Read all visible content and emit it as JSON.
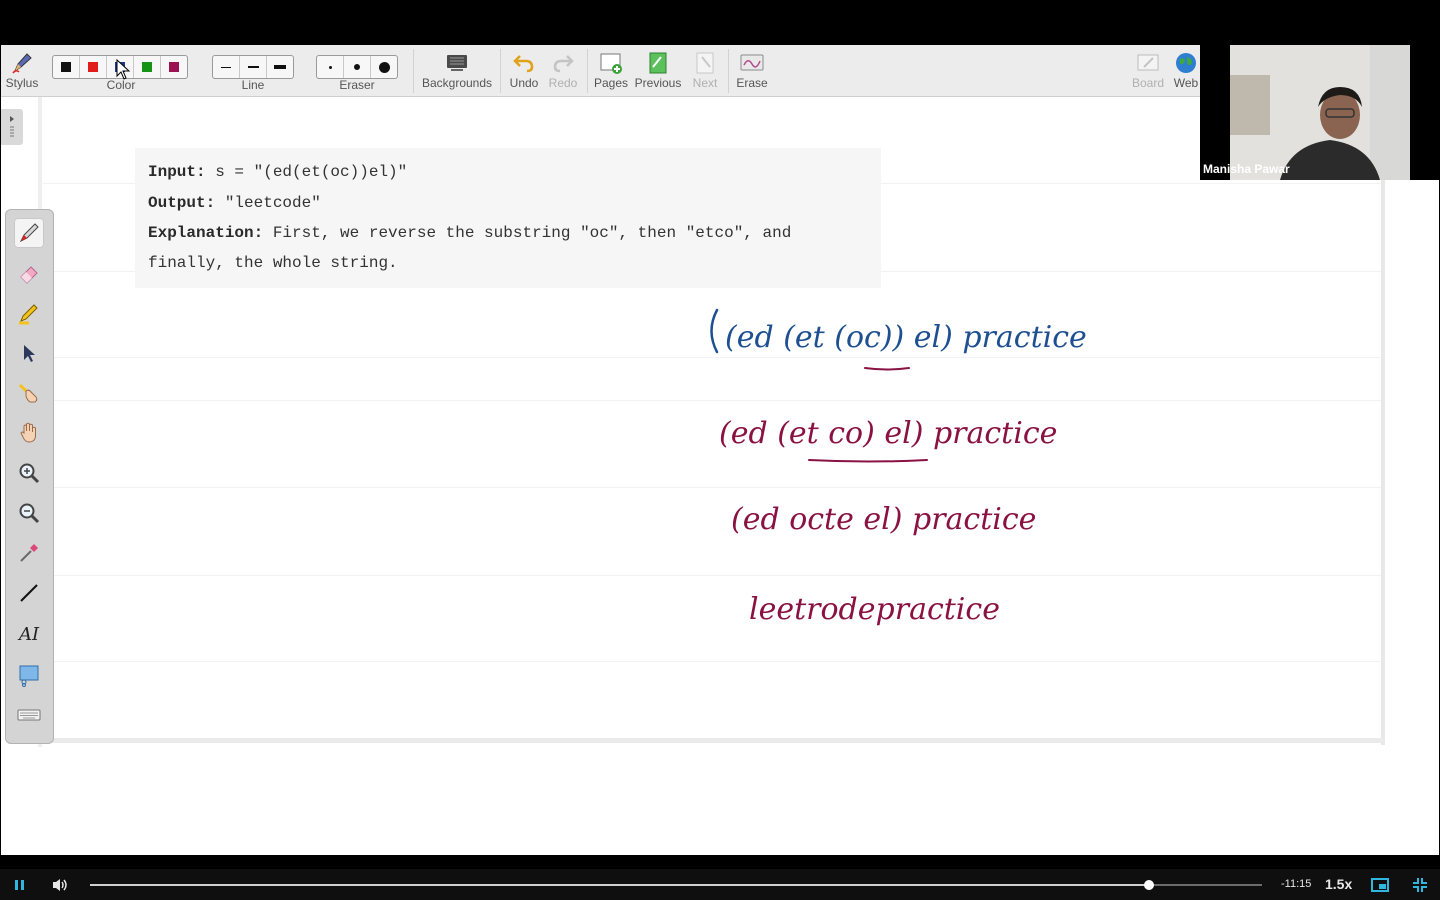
{
  "toolbar": {
    "stylus_label": "Stylus",
    "color_label": "Color",
    "colors": [
      "#111111",
      "#e21b1b",
      "#1f3a8a",
      "#159415",
      "#9b1352"
    ],
    "line_label": "Line",
    "eraser_label": "Eraser",
    "backgrounds_label": "Backgrounds",
    "undo_label": "Undo",
    "redo_label": "Redo",
    "pages_label": "Pages",
    "previous_label": "Previous",
    "next_label": "Next",
    "erase_label": "Erase",
    "board_label": "Board",
    "web_label": "Web"
  },
  "snippet": {
    "input_key": "Input:",
    "input_value": " s = \"(ed(et(oc))el)\"",
    "output_key": "Output:",
    "output_value": " \"leetcode\"",
    "explanation_key": "Explanation:",
    "explanation_value": " First, we reverse the substring \"oc\", then \"etco\", and",
    "explanation_cont": "finally, the whole string."
  },
  "handwriting": {
    "line1": "(ed (et (oc)) el) practice",
    "line2": "(ed (et co) el) practice",
    "line3": "(ed octe el)  practice",
    "line4": "leetrodepractice",
    "ink_blue": "#1d4f91",
    "ink_magenta": "#8a1242"
  },
  "palette": {
    "tools": [
      "pen-icon",
      "highlighter-eraser-icon",
      "highlighter-icon",
      "select-arrow-icon",
      "pointer-hand-icon",
      "pan-hand-icon",
      "zoom-in-icon",
      "zoom-out-icon",
      "eyedropper-icon",
      "line-tool-icon",
      "text-tool-icon",
      "screen-capture-icon",
      "keyboard-icon"
    ]
  },
  "webcam": {
    "presenter_name": "Manisha Pawar"
  },
  "player": {
    "time_remaining": "-11:15",
    "speed": "1.5x",
    "progress": 0.904
  }
}
